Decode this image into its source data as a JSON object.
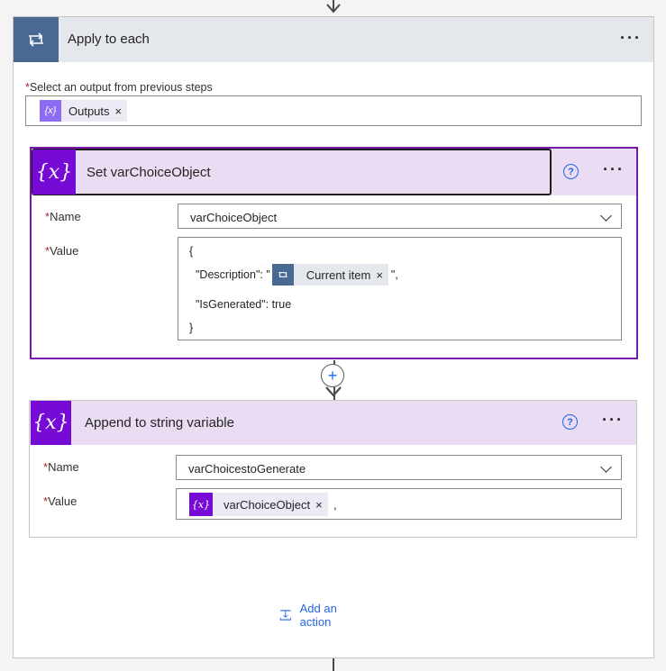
{
  "apply": {
    "title": "Apply to each",
    "more_label": "···",
    "field_required": "*",
    "field_label": "Select an output from previous steps",
    "token_icon": "{x}",
    "token_label": "Outputs",
    "token_remove": "×"
  },
  "set_var": {
    "title": "Set varChoiceObject",
    "help_label": "?",
    "more_label": "···",
    "icon_text": "{x}",
    "name_label": "Name",
    "name_value": "varChoiceObject",
    "value_label": "Value",
    "required": "*",
    "code": {
      "line1": "{",
      "desc_key": "\"Description\": \"",
      "token_label": "Current item",
      "token_remove": "×",
      "desc_end": "\",",
      "line3": "\"IsGenerated\": true",
      "line4": "}"
    }
  },
  "plus_label": "+",
  "append_var": {
    "title": "Append to string variable",
    "help_label": "?",
    "more_label": "···",
    "icon_text": "{x}",
    "name_label": "Name",
    "name_value": "varChoicestoGenerate",
    "value_label": "Value",
    "required": "*",
    "token_icon": "{x}",
    "token_label": "varChoiceObject",
    "token_remove": "×",
    "trailing_text": ","
  },
  "add_action_label": "Add an action",
  "colors": {
    "accent_blue": "#2266e3",
    "loop_icon_bg": "#486991",
    "variable_purple": "#770bd6",
    "card_header_lavender": "#e9dcf3"
  }
}
